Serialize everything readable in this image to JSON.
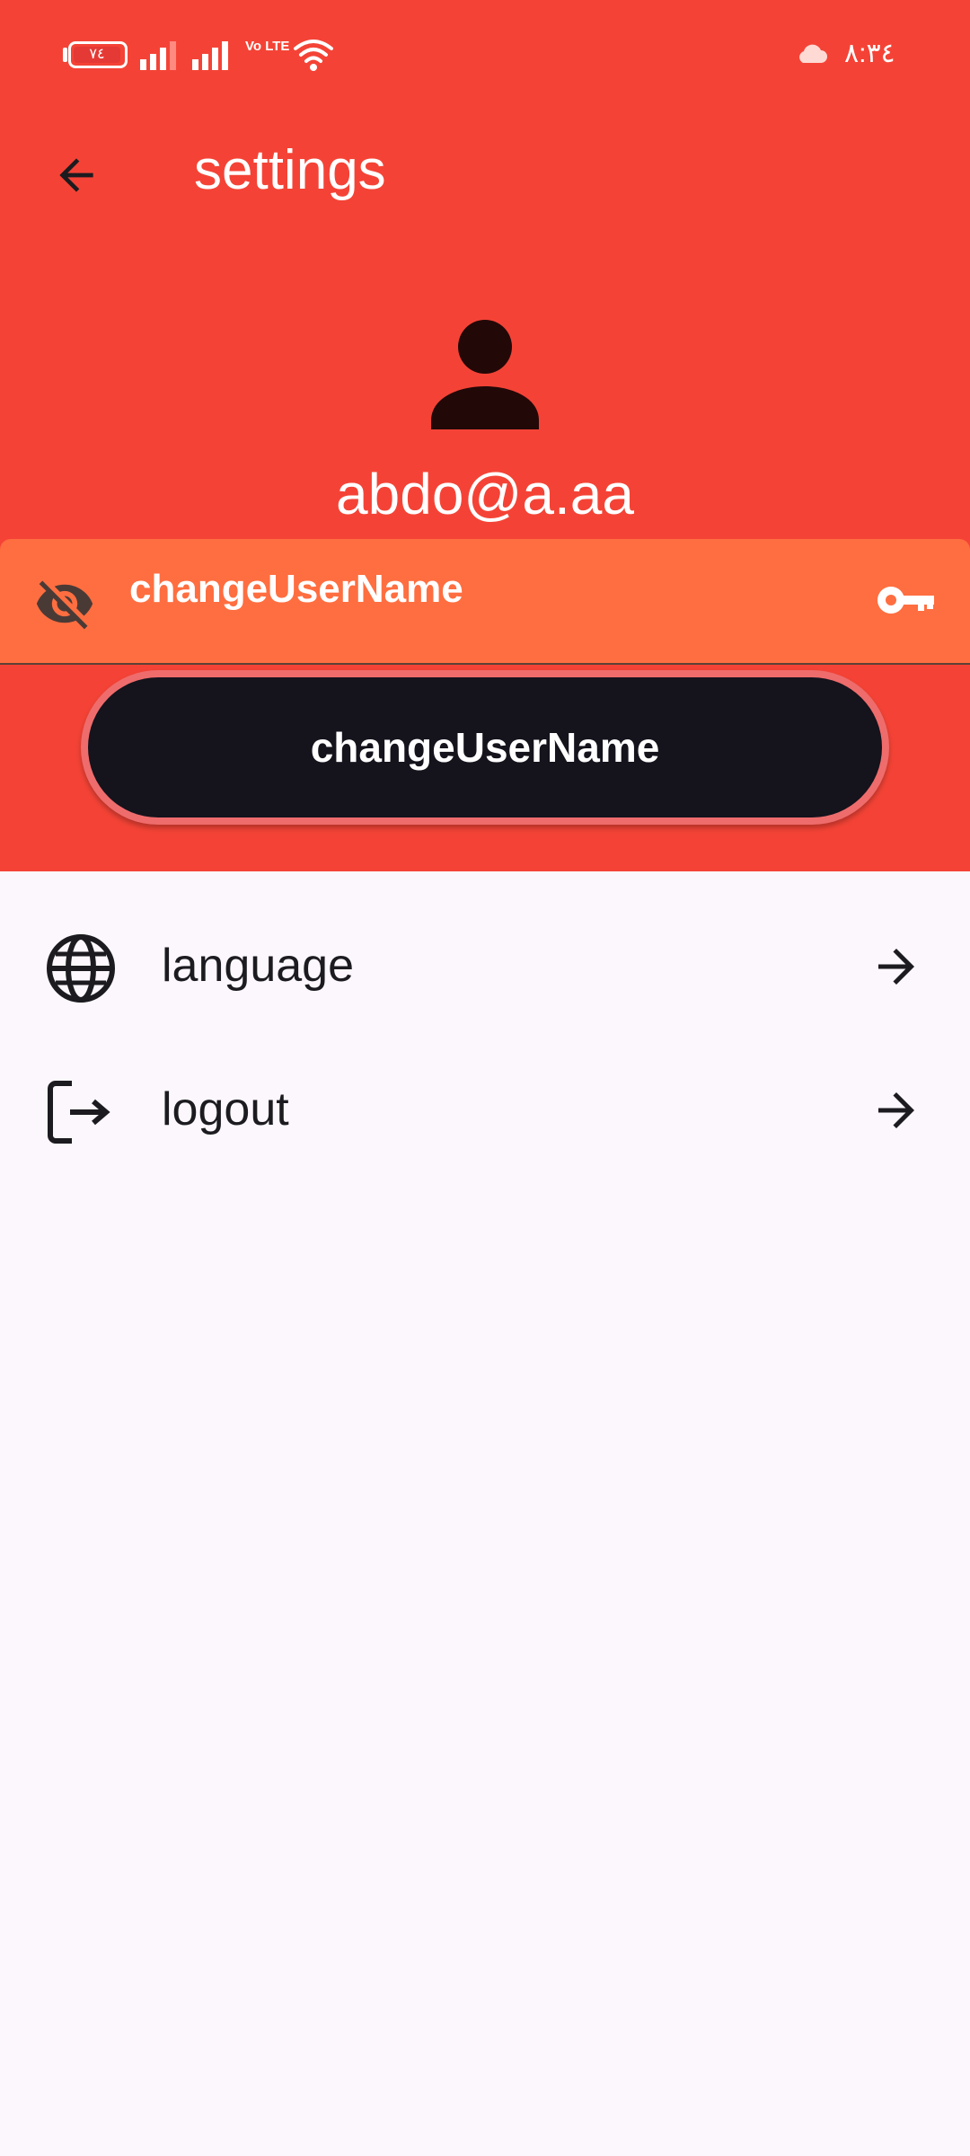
{
  "status_bar": {
    "battery_level": "٧٤",
    "network_label": "Vo LTE",
    "time": "٨:٣٤",
    "icons": [
      "battery-icon",
      "signal-icon",
      "signal-icon",
      "volte-icon",
      "wifi-icon",
      "cloud-icon"
    ]
  },
  "app_bar": {
    "title": "settings",
    "back_icon": "arrow-back-icon"
  },
  "profile": {
    "avatar_icon": "person-icon",
    "email": "abdo@a.aa"
  },
  "username_field": {
    "value": "changeUserName",
    "leading_icon": "visibility-off-icon",
    "trailing_icon": "key-icon"
  },
  "change_button": {
    "label": "changeUserName"
  },
  "menu": {
    "items": [
      {
        "label": "language",
        "icon": "globe-icon",
        "trailing_icon": "arrow-forward-icon"
      },
      {
        "label": "logout",
        "icon": "logout-icon",
        "trailing_icon": "arrow-forward-icon"
      }
    ]
  },
  "colors": {
    "header_background": "#f44336",
    "field_background": "#ff6e40",
    "button_background": "#15131c",
    "button_outline": "#ef6c6c",
    "page_background": "#fcf7fc",
    "text_on_header": "#ffffff",
    "text_primary": "#1c1b1f"
  }
}
